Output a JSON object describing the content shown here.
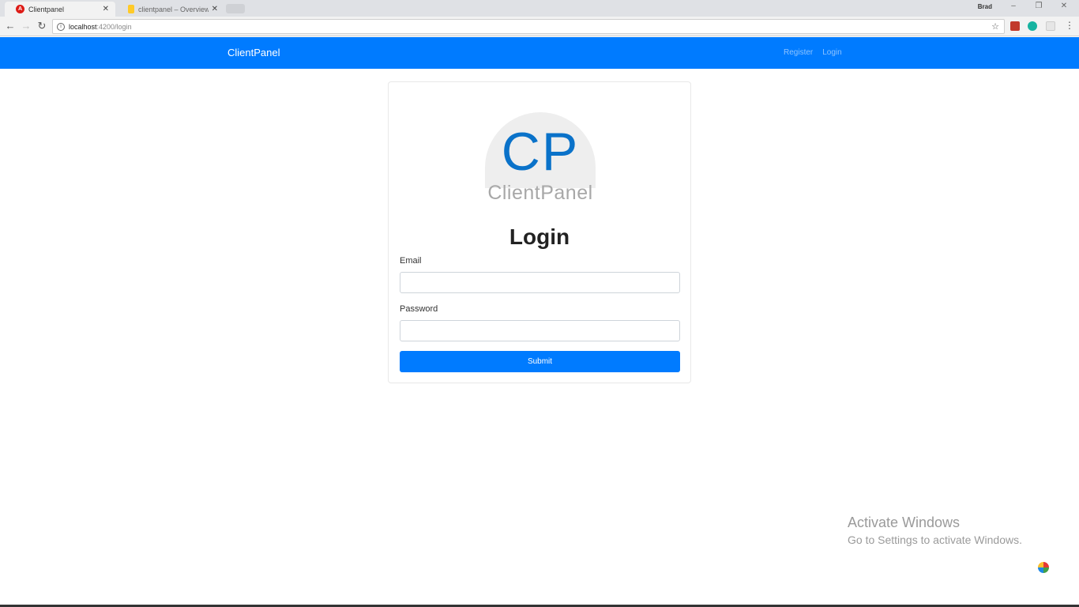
{
  "browser": {
    "tabs": [
      {
        "title": "Clientpanel",
        "favicon": "angular-icon",
        "active": true
      },
      {
        "title": "clientpanel – Overview –",
        "favicon": "firebase-icon",
        "active": false
      }
    ],
    "profile_name": "Brad",
    "window_controls": {
      "minimize": "–",
      "restore": "❐",
      "close": "✕"
    },
    "url_host": "localhost",
    "url_path": ":4200/login"
  },
  "navbar": {
    "brand": "ClientPanel",
    "links": [
      "Register",
      "Login"
    ],
    "color": "#007bff"
  },
  "login": {
    "logo_initials": "CP",
    "logo_text": "ClientPanel",
    "title": "Login",
    "email_label": "Email",
    "email_value": "",
    "password_label": "Password",
    "password_value": "",
    "submit_label": "Submit"
  },
  "watermark": {
    "title": "Activate Windows",
    "subtitle": "Go to Settings to activate Windows."
  }
}
